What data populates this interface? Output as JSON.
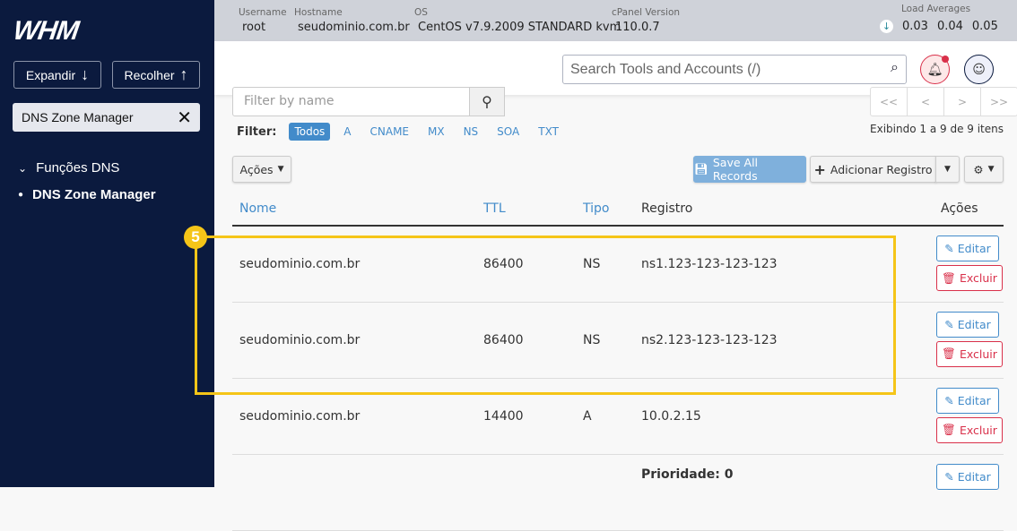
{
  "sidebar": {
    "logo": "WHM",
    "expand": "Expandir",
    "collapse": "Recolher",
    "filter_value": "DNS Zone Manager",
    "group": "Funções DNS",
    "item": "DNS Zone Manager"
  },
  "infobar": {
    "username_label": "Username",
    "username": "root",
    "hostname_label": "Hostname",
    "hostname": "seudominio.com.br",
    "os_label": "OS",
    "os": "CentOS v7.9.2009 STANDARD kvm",
    "cpanel_label": "cPanel Version",
    "cpanel": "110.0.7",
    "load_label": "Load Averages",
    "load": [
      "0.03",
      "0.04",
      "0.05"
    ]
  },
  "header": {
    "search_placeholder": "Search Tools and Accounts (/)"
  },
  "toolbar": {
    "filter_placeholder": "Filter by name",
    "filter_label": "Filter:",
    "chips": [
      "Todos",
      "A",
      "CNAME",
      "MX",
      "NS",
      "SOA",
      "TXT"
    ],
    "pager": [
      "<<",
      "<",
      ">",
      ">>"
    ],
    "showing": "Exibindo 1 a 9 de 9 itens",
    "actions": "Ações",
    "save_all": "Save All Records",
    "add": "Adicionar Registro"
  },
  "table": {
    "headers": [
      "Nome",
      "TTL",
      "Tipo",
      "Registro",
      "Ações"
    ],
    "rows": [
      {
        "name": "seudominio.com.br",
        "ttl": "86400",
        "type": "NS",
        "record": "ns1.123-123-123-123"
      },
      {
        "name": "seudominio.com.br",
        "ttl": "86400",
        "type": "NS",
        "record": "ns2.123-123-123-123"
      },
      {
        "name": "seudominio.com.br",
        "ttl": "14400",
        "type": "A",
        "record": "10.0.2.15"
      },
      {
        "name": "",
        "ttl": "",
        "type": "",
        "record": "Prioridade: 0"
      }
    ],
    "edit": "Editar",
    "delete": "Excluir"
  },
  "annotation": {
    "number": "5",
    "color": "#f5c518"
  }
}
